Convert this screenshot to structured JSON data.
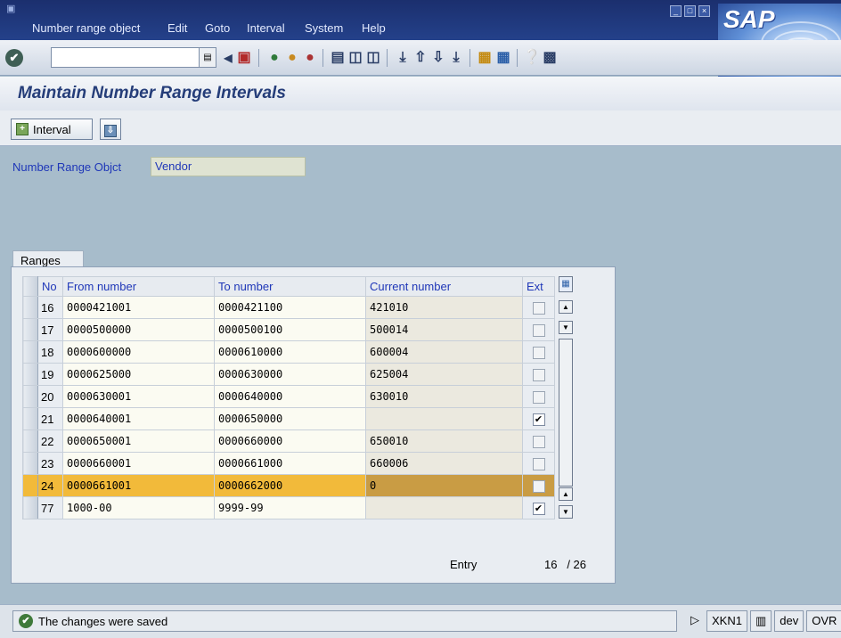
{
  "menubar": {
    "items": [
      "Number range object",
      "Edit",
      "Goto",
      "Interval",
      "System",
      "Help"
    ],
    "logo": "SAP"
  },
  "toolbar": {
    "okcode_value": "",
    "icons": [
      "back-icon",
      "save-icon",
      "nav-back-icon",
      "exit-icon",
      "cancel-icon",
      "print-icon",
      "find-icon",
      "find-next-icon",
      "first-page-icon",
      "previous-page-icon",
      "next-page-icon",
      "last-page-icon",
      "create-session-icon",
      "shortcut-icon",
      "help-icon",
      "layout-icon"
    ]
  },
  "page": {
    "title": "Maintain Number Range Intervals"
  },
  "app_toolbar": {
    "interval_label": "Interval"
  },
  "object": {
    "label": "Number Range Objct",
    "value": "Vendor"
  },
  "ranges": {
    "tab_label": "Ranges",
    "headers": {
      "no": "No",
      "from": "From number",
      "to": "To number",
      "current": "Current number",
      "ext": "Ext"
    },
    "rows": [
      {
        "no": "16",
        "from": "0000421001",
        "to": "0000421100",
        "current": "421010",
        "ext": false
      },
      {
        "no": "17",
        "from": "0000500000",
        "to": "0000500100",
        "current": "500014",
        "ext": false
      },
      {
        "no": "18",
        "from": "0000600000",
        "to": "0000610000",
        "current": "600004",
        "ext": false
      },
      {
        "no": "19",
        "from": "0000625000",
        "to": "0000630000",
        "current": "625004",
        "ext": false
      },
      {
        "no": "20",
        "from": "0000630001",
        "to": "0000640000",
        "current": "630010",
        "ext": false
      },
      {
        "no": "21",
        "from": "0000640001",
        "to": "0000650000",
        "current": "",
        "ext": true
      },
      {
        "no": "22",
        "from": "0000650001",
        "to": "0000660000",
        "current": "650010",
        "ext": false
      },
      {
        "no": "23",
        "from": "0000660001",
        "to": "0000661000",
        "current": "660006",
        "ext": false
      },
      {
        "no": "24",
        "from": "0000661001",
        "to": "0000662000",
        "current": "0",
        "ext": false
      },
      {
        "no": "77",
        "from": "1000-00",
        "to": "9999-99",
        "current": "",
        "ext": true
      }
    ],
    "highlighted_row": "24",
    "entry_label": "Entry",
    "entry_current": "16",
    "entry_total": "/ 26"
  },
  "status": {
    "message": "The changes were saved",
    "transaction": "XKN1",
    "system": "dev",
    "mode": "OVR"
  },
  "colors": {
    "menubar": "#1b2f6e",
    "background": "#a7bccb",
    "highlight": "#f2ba3a",
    "label_blue": "#1f37b8"
  }
}
